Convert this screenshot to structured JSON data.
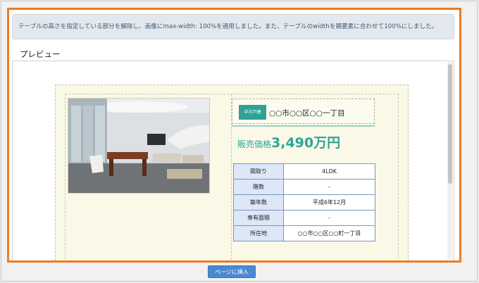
{
  "notice": {
    "text": "テーブルの高さを指定している部分を解除し、画像にmax-width: 100%を適用しました。また、テーブルのwidthを親要素に合わせて100%にしました。"
  },
  "preview": {
    "title": "プレビュー"
  },
  "listing": {
    "badge": "中古戸建",
    "address": "○○市○○区○○一丁目",
    "price_label": "販売価格",
    "price_value": "3,490万円",
    "specs": [
      {
        "label": "間取り",
        "value": "4LDK"
      },
      {
        "label": "階数",
        "value": "-"
      },
      {
        "label": "築年数",
        "value": "平成6年12月"
      },
      {
        "label": "専有面積",
        "value": "-"
      },
      {
        "label": "所在地",
        "value": "○○市○○区○○町一丁目"
      }
    ]
  },
  "actions": {
    "insert_label": "ページに挿入"
  },
  "colors": {
    "accent_border": "#ee7a22",
    "price_teal": "#2ea698",
    "badge_teal": "#2fa195",
    "button_blue": "#4a89cf"
  }
}
